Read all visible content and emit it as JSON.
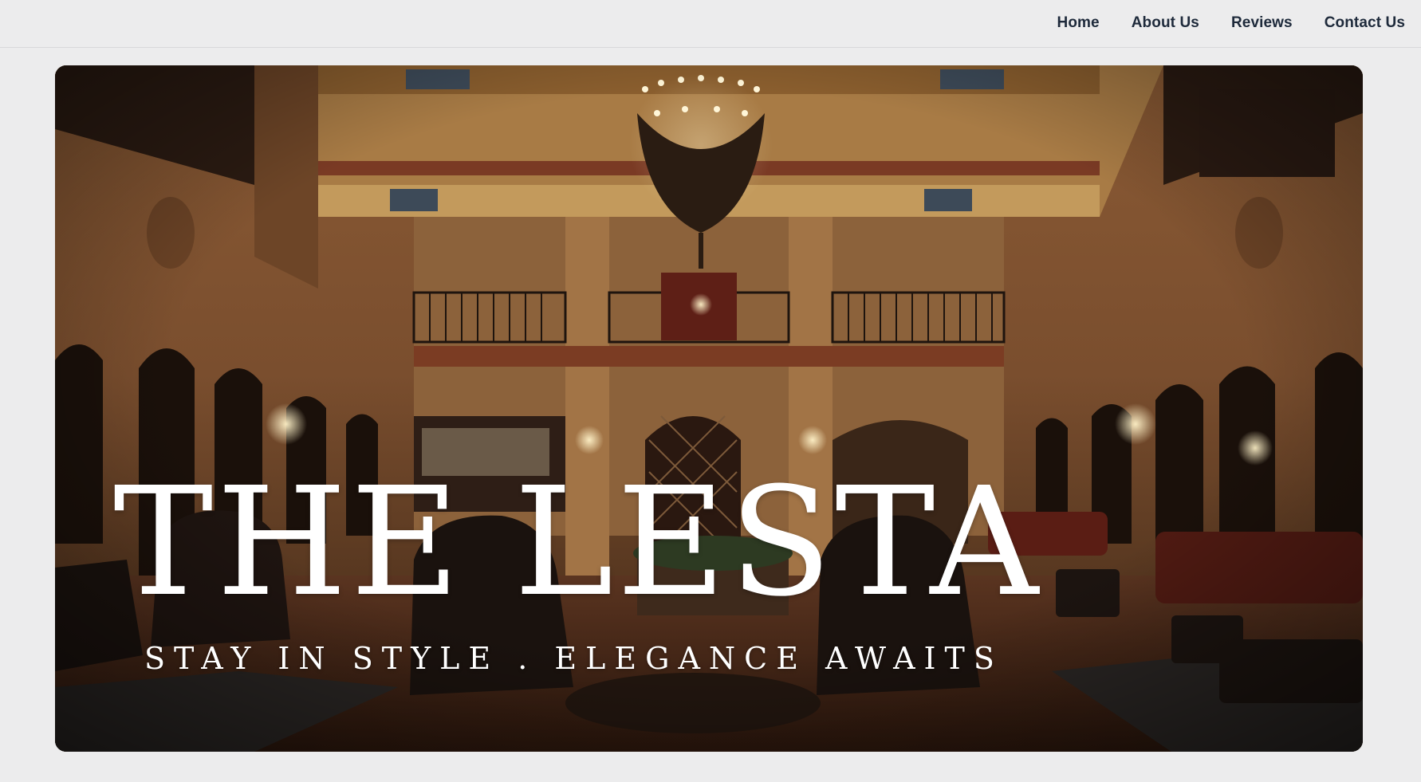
{
  "nav": {
    "items": [
      {
        "label": "Home"
      },
      {
        "label": "About Us"
      },
      {
        "label": "Reviews"
      },
      {
        "label": "Contact Us"
      }
    ]
  },
  "hero": {
    "title": "THE LESTA",
    "tagline": "STAY IN STYLE . ELEGANCE AWAITS",
    "image": "hotel-lobby-photo",
    "colors": {
      "nav_text": "#1e2a3b",
      "page_background": "#ececed",
      "hero_text": "#ffffff"
    }
  }
}
